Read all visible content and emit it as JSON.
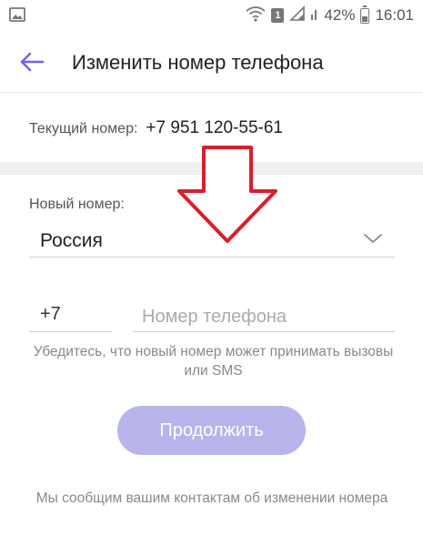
{
  "status_bar": {
    "battery_percent": "42%",
    "time": "16:01",
    "sim_badge": "1",
    "icons": [
      "gallery-icon",
      "wifi-icon",
      "sim-badge-icon",
      "signal-icon",
      "battery-icon"
    ]
  },
  "app_bar": {
    "title": "Изменить номер телефона",
    "back_icon": "arrow-left-icon"
  },
  "current_number": {
    "label": "Текущий номер:",
    "value": "+7 951 120-55-61"
  },
  "form": {
    "new_number_label": "Новый номер:",
    "country": "Россия",
    "country_dropdown_icon": "chevron-down-icon",
    "country_code": "+7",
    "phone_placeholder": "Номер телефона",
    "phone_value": "",
    "hint": "Убедитесь, что новый номер может принимать вызовы или SMS",
    "continue_label": "Продолжить",
    "continue_enabled": false
  },
  "footer_note": "Мы сообщим вашим контактам об изменении номера",
  "colors": {
    "accent": "#7360f2",
    "button_disabled": "#b9b3ec",
    "annotation_arrow": "#d6202a"
  }
}
